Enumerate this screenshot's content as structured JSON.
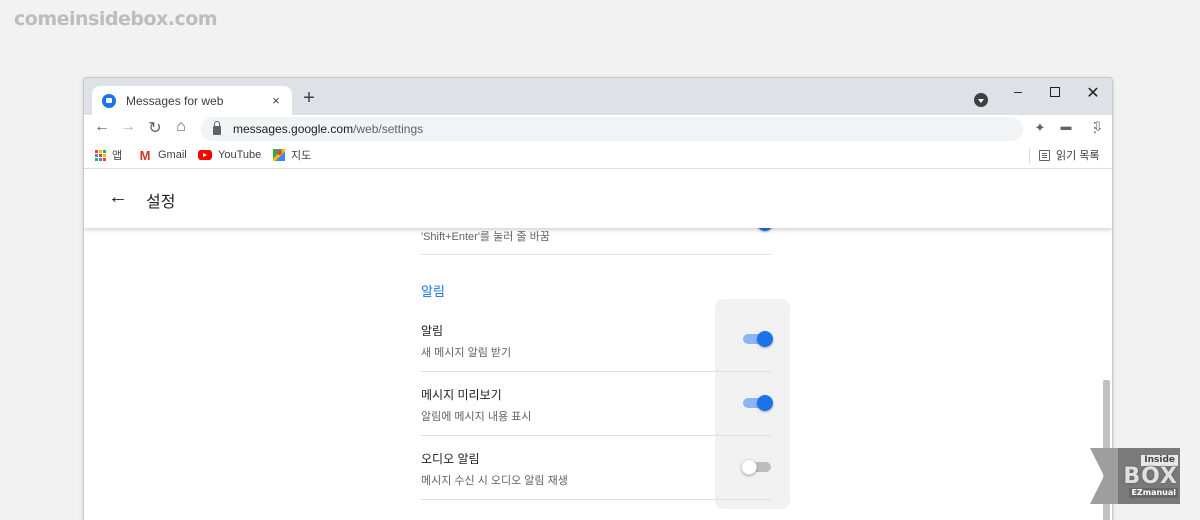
{
  "watermark": "comeinsidebox.com",
  "browser": {
    "tab": {
      "title": "Messages for web",
      "close": "×"
    },
    "new_tab": "+",
    "window": {
      "minimize": "–",
      "close": "✕"
    },
    "nav": {
      "back": "←",
      "forward": "→",
      "reload": "↻",
      "home": "⌂"
    },
    "omnibox": {
      "host": "messages.google.com",
      "path": "/web/settings"
    },
    "omni_icons": {
      "install": "⇩",
      "star": "☆"
    },
    "toolbar_icons": {
      "extensions": "✦",
      "account": "▬",
      "menu": "⋮"
    },
    "bookmarks": [
      {
        "label": "앱",
        "icon": "apps-icon"
      },
      {
        "label": "Gmail",
        "icon": "gmail-icon"
      },
      {
        "label": "YouTube",
        "icon": "youtube-icon"
      },
      {
        "label": "지도",
        "icon": "maps-icon"
      }
    ],
    "gmail_glyph": "M",
    "reading_list": "읽기 목록"
  },
  "app": {
    "back": "←",
    "title": "설정",
    "cut_off_text": "'Shift+Enter'를 눌러 줄 바꿈",
    "section_title": "알림",
    "settings": [
      {
        "title": "알림",
        "subtitle": "새 메시지 알림 받기",
        "enabled": true
      },
      {
        "title": "메시지 미리보기",
        "subtitle": "알림에 메시지 내용 표시",
        "enabled": true
      },
      {
        "title": "오디오 알림",
        "subtitle": "메시지 수신 시 오디오 알림 재생",
        "enabled": false
      }
    ]
  },
  "logo": {
    "line1": "Inside",
    "line2": "BOX",
    "line3": "EZmanual"
  },
  "colors": {
    "accent": "#1a73e8",
    "toggle_track_on": "#8ab4f8",
    "section_title": "#1a73e8"
  }
}
